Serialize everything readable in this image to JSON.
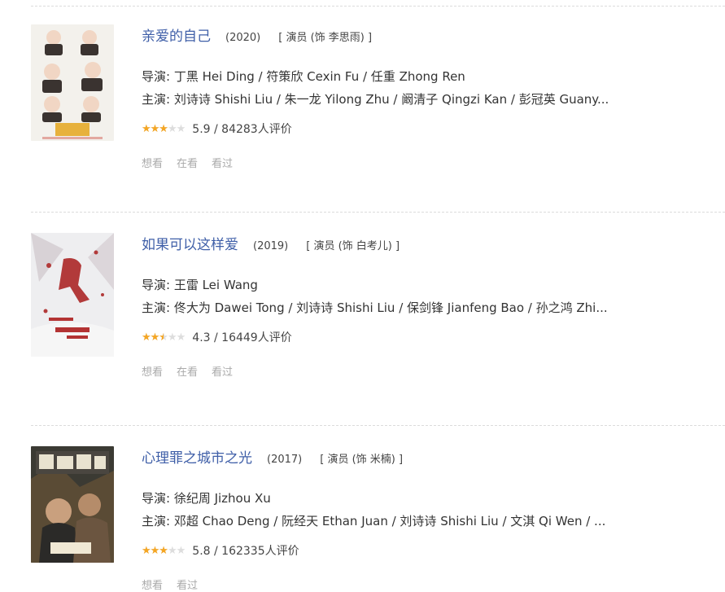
{
  "films": [
    {
      "title": "亲爱的自己",
      "year": "(2020)",
      "role": "[ 演员 (饰 李思雨) ]",
      "directors": "导演: 丁黑 Hei Ding / 符策欣 Cexin Fu / 任重 Zhong Ren",
      "cast": "主演: 刘诗诗 Shishi Liu / 朱一龙 Yilong Zhu / 阚清子 Qingzi Kan / 彭冠英 Guany...",
      "star_fraction": 0.6,
      "rating_text": "5.9 / 84283人评价",
      "marks": [
        "想看",
        "在看",
        "看过"
      ]
    },
    {
      "title": "如果可以这样爱",
      "year": "(2019)",
      "role": "[ 演员 (饰 白考儿) ]",
      "directors": "导演: 王雷 Lei Wang",
      "cast": "主演: 佟大为 Dawei Tong / 刘诗诗 Shishi Liu / 保剑锋 Jianfeng Bao / 孙之鸿 Zhi...",
      "star_fraction": 0.5,
      "rating_text": "4.3 / 16449人评价",
      "marks": [
        "想看",
        "在看",
        "看过"
      ]
    },
    {
      "title": "心理罪之城市之光",
      "year": "(2017)",
      "role": "[ 演员 (饰 米楠) ]",
      "directors": "导演: 徐纪周 Jizhou Xu",
      "cast": "主演: 邓超 Chao Deng / 阮经天 Ethan Juan / 刘诗诗 Shishi Liu / 文淇 Qi Wen / ...",
      "star_fraction": 0.6,
      "rating_text": "5.8 / 162335人评价",
      "marks": [
        "想看",
        "看过"
      ]
    }
  ],
  "colors": {
    "title": "#3f5fa8",
    "star": "#f5a623"
  }
}
